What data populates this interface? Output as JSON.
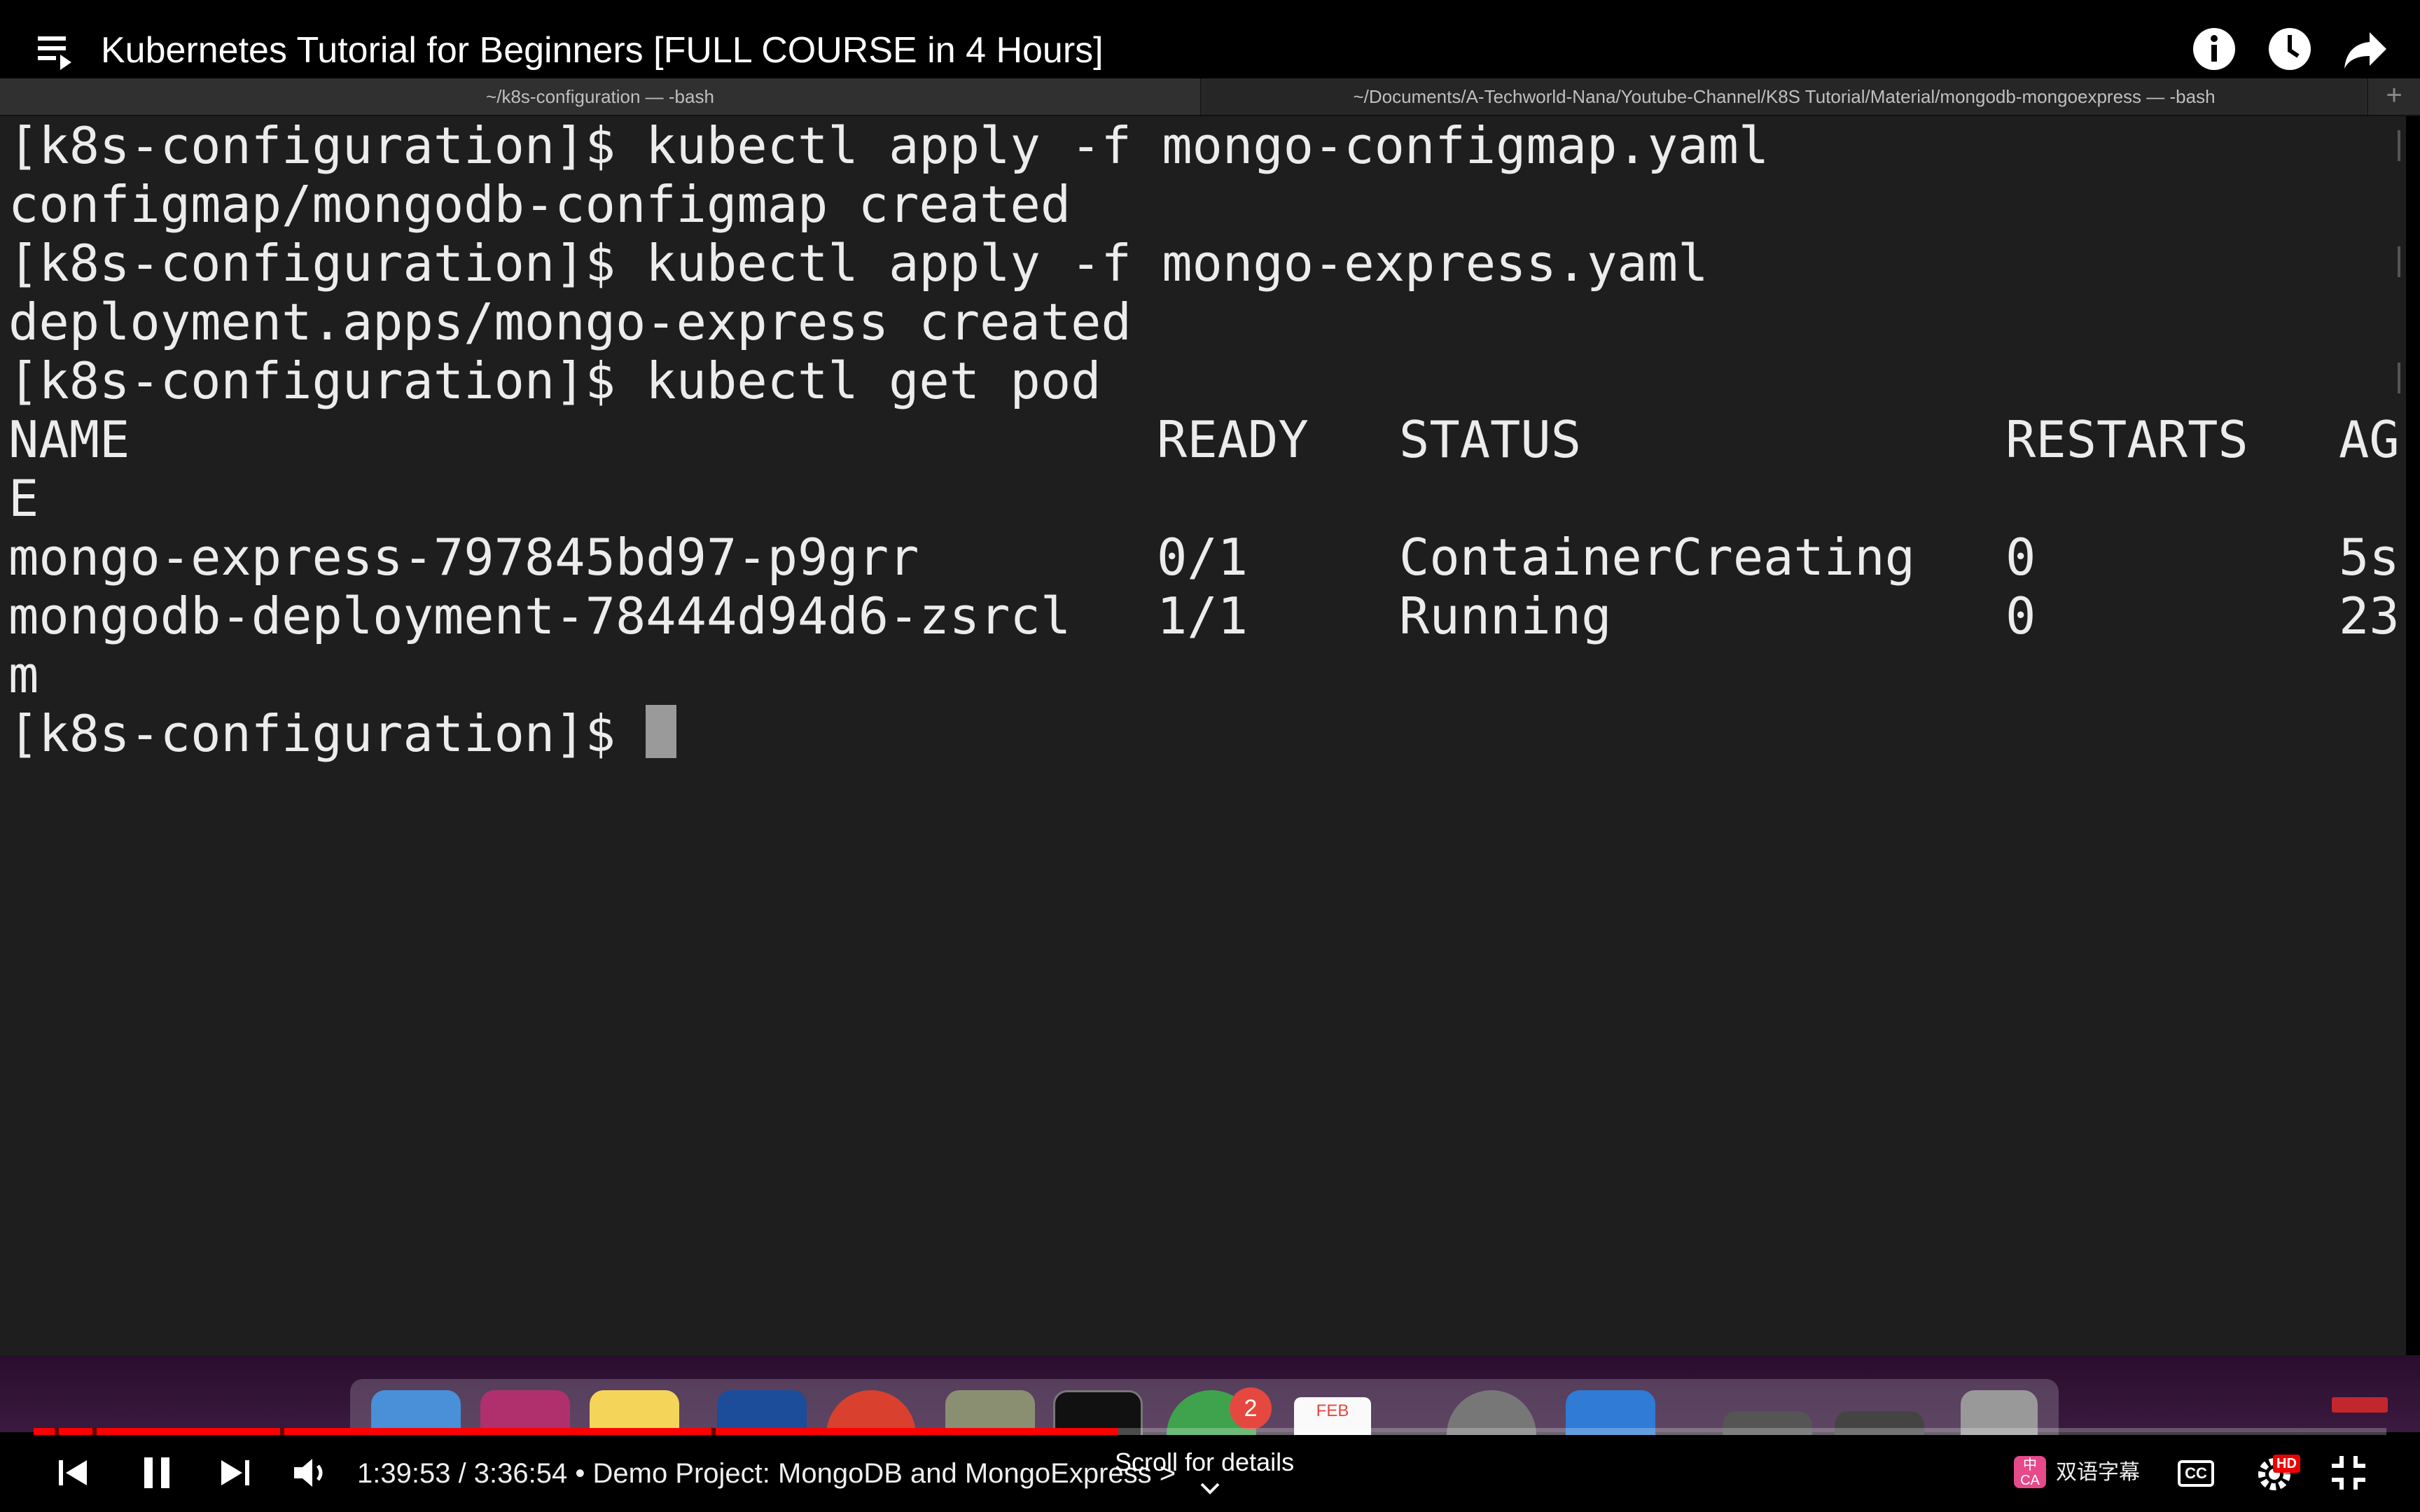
{
  "video": {
    "title": "Kubernetes Tutorial for Beginners [FULL COURSE in 4 Hours]",
    "current_time": "1:39:53",
    "duration": "3:36:54",
    "chapter": "Demo Project: MongoDB and MongoExpress",
    "time_display": "1:39:53 / 3:36:54 • Demo Project: MongoDB and MongoExpress >",
    "progress_fraction": 0.461,
    "scroll_hint": "Scroll for details",
    "subtitles_label": "双语字幕",
    "subtitles_icon_text": "中\nCA",
    "cc_label": "CC",
    "hd_label": "HD",
    "accent_color": "#ff0000"
  },
  "top_icons": [
    "playlist-icon",
    "info-icon",
    "watch-later-icon",
    "share-icon"
  ],
  "terminal": {
    "tabs": [
      {
        "label": "~/k8s-configuration — -bash",
        "active": true
      },
      {
        "label": "~/Documents/A-Techworld-Nana/Youtube-Channel/K8S Tutorial/Material/mongodb-mongoexpress — -bash",
        "active": false
      }
    ],
    "add_tab_label": "+",
    "prompt": "[k8s-configuration]$",
    "lines": [
      {
        "type": "command",
        "text": "[k8s-configuration]$ kubectl apply -f mongo-configmap.yaml"
      },
      {
        "type": "output",
        "text": "configmap/mongodb-configmap created"
      },
      {
        "type": "command",
        "text": "[k8s-configuration]$ kubectl apply -f mongo-express.yaml"
      },
      {
        "type": "output",
        "text": "deployment.apps/mongo-express created"
      },
      {
        "type": "command",
        "text": "[k8s-configuration]$ kubectl get pod"
      }
    ],
    "pod_table": {
      "headers": [
        "NAME",
        "READY",
        "STATUS",
        "RESTARTS",
        "AG"
      ],
      "header_wrap": "E",
      "rows": [
        {
          "name": "mongo-express-797845bd97-p9grr",
          "ready": "0/1",
          "status": "ContainerCreating",
          "restarts": "0",
          "age": "5s",
          "wrap": ""
        },
        {
          "name": "mongodb-deployment-78444d94d6-zsrcl",
          "ready": "1/1",
          "status": "Running",
          "restarts": "0",
          "age": "23",
          "wrap": "m"
        }
      ]
    }
  },
  "dock": {
    "badge_count": "2",
    "calendar_month": "FEB"
  }
}
